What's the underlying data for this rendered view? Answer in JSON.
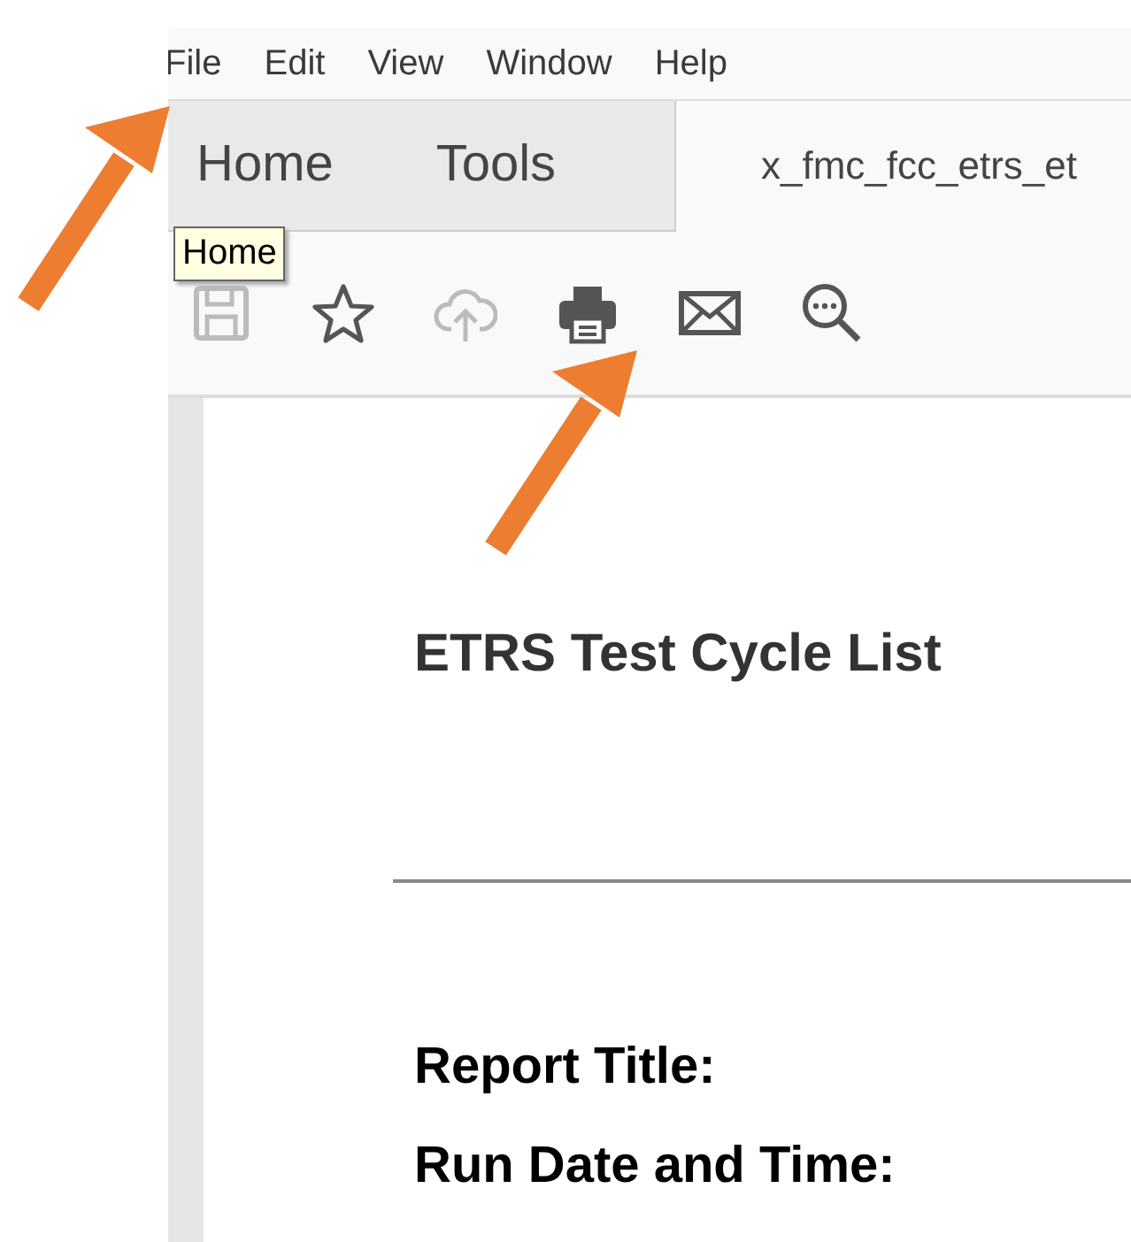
{
  "menu_bar": [
    "File",
    "Edit",
    "View",
    "Window",
    "Help"
  ],
  "tabs": [
    {
      "label": "Home",
      "selected": false
    },
    {
      "label": "Tools",
      "selected": false
    },
    {
      "label": "x_fmc_fcc_etrs_et",
      "selected": true
    }
  ],
  "tooltip": "Home",
  "toolbar": [
    {
      "kind": "save",
      "disabled": true
    },
    {
      "kind": "star",
      "disabled": false
    },
    {
      "kind": "upload",
      "disabled": true
    },
    {
      "kind": "print",
      "disabled": false
    },
    {
      "kind": "mail",
      "disabled": false
    },
    {
      "kind": "zoom",
      "disabled": false
    }
  ],
  "document": {
    "title": "ETRS Test Cycle List",
    "fields": [
      "Report Title:",
      "Run Date and Time:"
    ]
  }
}
